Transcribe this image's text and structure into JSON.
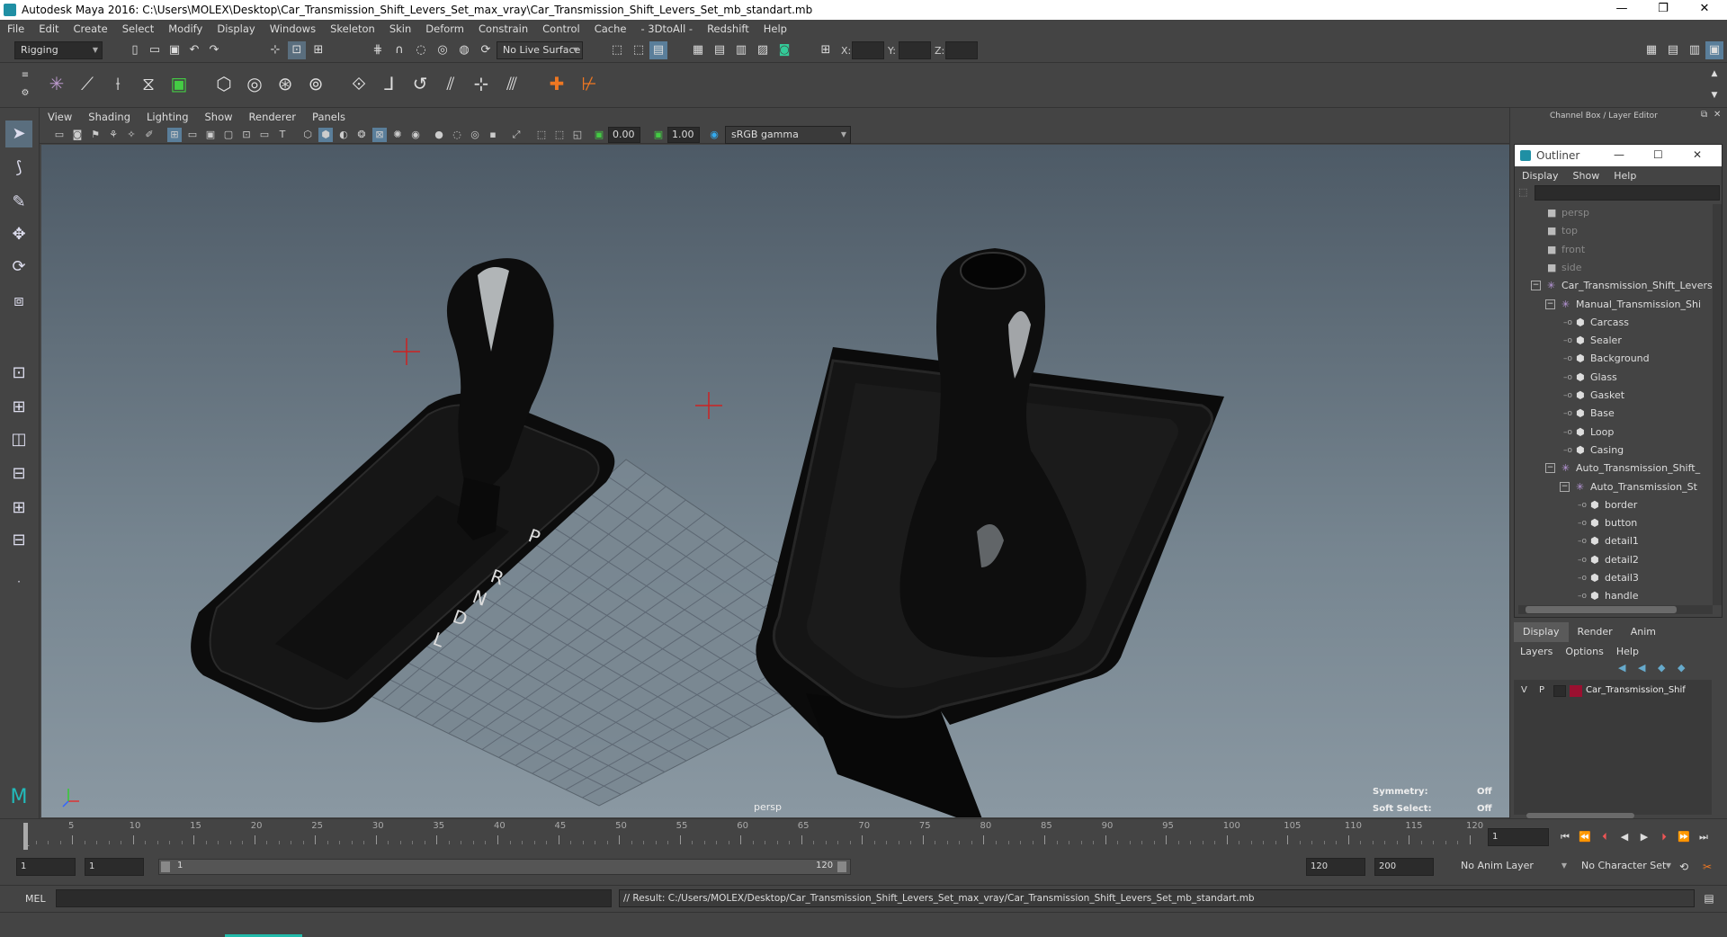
{
  "title_bar": {
    "text": "Autodesk Maya 2016: C:\\Users\\MOLEX\\Desktop\\Car_Transmission_Shift_Levers_Set_max_vray\\Car_Transmission_Shift_Levers_Set_mb_standart.mb",
    "min": "—",
    "max": "❐",
    "close": "✕"
  },
  "menu": [
    "File",
    "Edit",
    "Create",
    "Select",
    "Modify",
    "Display",
    "Windows",
    "Skeleton",
    "Skin",
    "Deform",
    "Constrain",
    "Control",
    "Cache",
    "- 3DtoAll -",
    "Redshift",
    "Help"
  ],
  "status_line": {
    "mode": "Rigging",
    "live_surface": "No Live Surface",
    "x_label": "X:",
    "y_label": "Y:",
    "z_label": "Z:"
  },
  "panel_menu": [
    "View",
    "Shading",
    "Lighting",
    "Show",
    "Renderer",
    "Panels"
  ],
  "panel_tools": {
    "val1": "0.00",
    "val2": "1.00",
    "color_space": "sRGB gamma"
  },
  "viewport": {
    "camera": "persp",
    "symmetry_label": "Symmetry:",
    "symmetry_value": "Off",
    "soft_select_label": "Soft Select:",
    "soft_select_value": "Off",
    "gear_labels": [
      "P",
      "R",
      "N",
      "D",
      "L"
    ]
  },
  "channel_box": {
    "title": "Channel Box / Layer Editor"
  },
  "outliner": {
    "title": "Outliner",
    "menu": [
      "Display",
      "Show",
      "Help"
    ],
    "items": [
      {
        "label": "persp",
        "depth": 0,
        "kind": "camera",
        "dim": true
      },
      {
        "label": "top",
        "depth": 0,
        "kind": "camera",
        "dim": true
      },
      {
        "label": "front",
        "depth": 0,
        "kind": "camera",
        "dim": true
      },
      {
        "label": "side",
        "depth": 0,
        "kind": "camera",
        "dim": true
      },
      {
        "label": "Car_Transmission_Shift_Levers",
        "depth": 0,
        "kind": "group",
        "expand": "−"
      },
      {
        "label": "Manual_Transmission_Shi",
        "depth": 1,
        "kind": "group",
        "expand": "−"
      },
      {
        "label": "Carcass",
        "depth": 2,
        "kind": "mesh"
      },
      {
        "label": "Sealer",
        "depth": 2,
        "kind": "mesh"
      },
      {
        "label": "Background",
        "depth": 2,
        "kind": "mesh"
      },
      {
        "label": "Glass",
        "depth": 2,
        "kind": "mesh"
      },
      {
        "label": "Gasket",
        "depth": 2,
        "kind": "mesh"
      },
      {
        "label": "Base",
        "depth": 2,
        "kind": "mesh"
      },
      {
        "label": "Loop",
        "depth": 2,
        "kind": "mesh"
      },
      {
        "label": "Casing",
        "depth": 2,
        "kind": "mesh"
      },
      {
        "label": "Auto_Transmission_Shift_",
        "depth": 1,
        "kind": "group",
        "expand": "−"
      },
      {
        "label": "Auto_Transmission_St",
        "depth": 2,
        "kind": "group",
        "expand": "−"
      },
      {
        "label": "border",
        "depth": 3,
        "kind": "mesh"
      },
      {
        "label": "button",
        "depth": 3,
        "kind": "mesh"
      },
      {
        "label": "detail1",
        "depth": 3,
        "kind": "mesh"
      },
      {
        "label": "detail2",
        "depth": 3,
        "kind": "mesh"
      },
      {
        "label": "detail3",
        "depth": 3,
        "kind": "mesh"
      },
      {
        "label": "handle",
        "depth": 3,
        "kind": "mesh"
      }
    ]
  },
  "layer_editor": {
    "tabs": [
      "Display",
      "Render",
      "Anim"
    ],
    "menu": [
      "Layers",
      "Options",
      "Help"
    ],
    "layer": {
      "v": "V",
      "p": "P",
      "name": "Car_Transmission_Shif",
      "color": "#9a1030"
    }
  },
  "time_slider": {
    "ticks": [
      1,
      5,
      10,
      15,
      20,
      25,
      30,
      35,
      40,
      45,
      50,
      55,
      60,
      65,
      70,
      75,
      80,
      85,
      90,
      95,
      100,
      105,
      110,
      115,
      120
    ],
    "current_frame": "1"
  },
  "range_slider": {
    "start": "1",
    "anim_start": "1",
    "range_start": "1",
    "range_end": "120",
    "end": "120",
    "anim_end": "200",
    "anim_layer": "No Anim Layer",
    "char_set": "No Character Set"
  },
  "command_line": {
    "label": "MEL",
    "result": "// Result: C:/Users/MOLEX/Desktop/Car_Transmission_Shift_Levers_Set_max_vray/Car_Transmission_Shift_Levers_Set_mb_standart.mb"
  }
}
